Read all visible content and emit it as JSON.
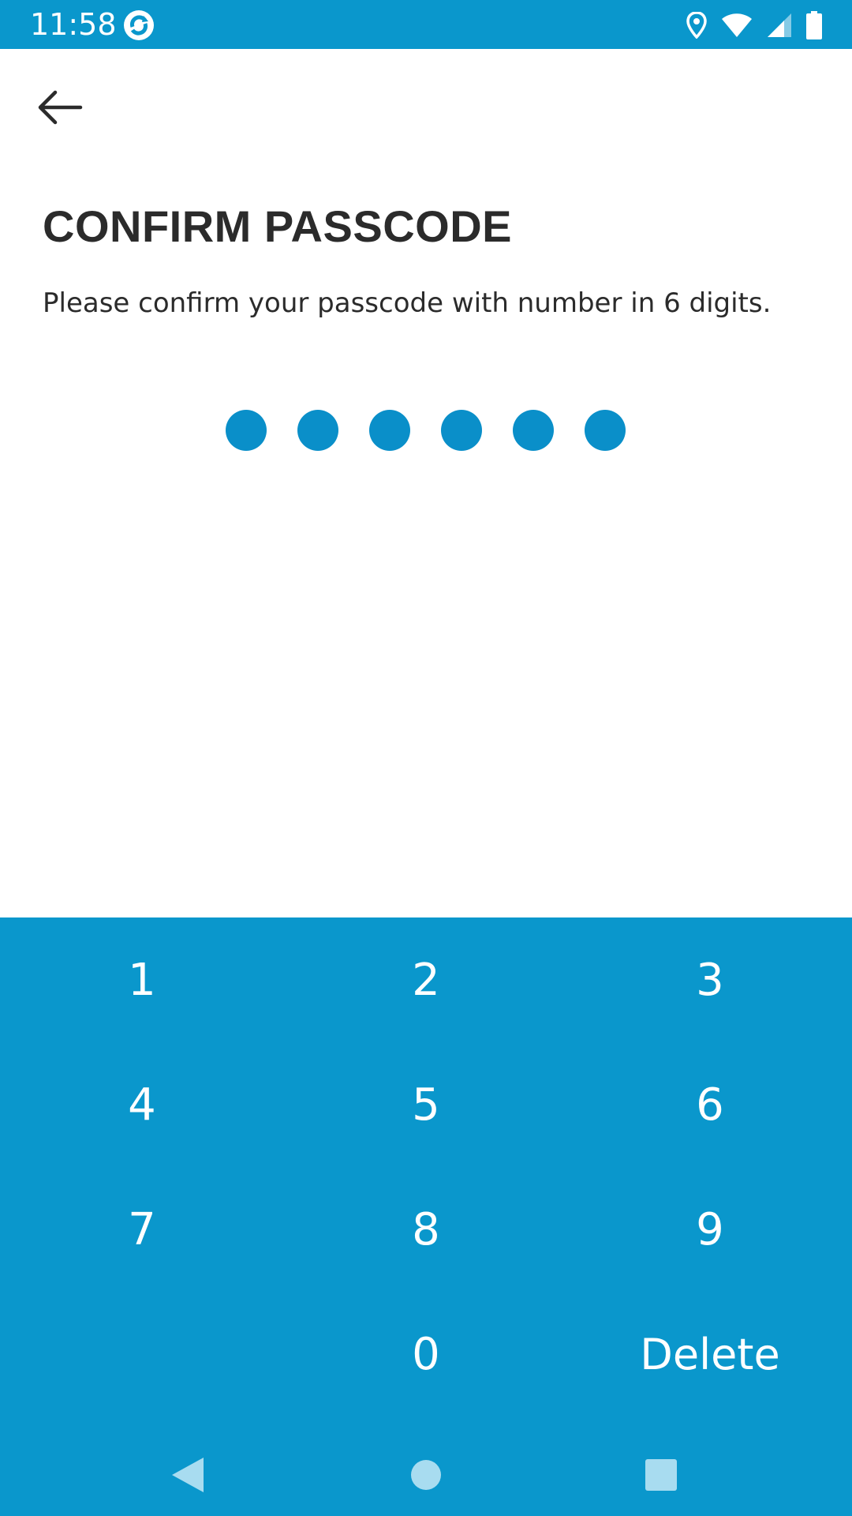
{
  "status_bar": {
    "time": "11:58",
    "icons": [
      "sync-app-icon",
      "location-icon",
      "wifi-icon",
      "signal-icon",
      "battery-icon"
    ]
  },
  "header": {
    "back_icon": "arrow-left-icon",
    "title": "CONFIRM PASSCODE",
    "subtitle": "Please confirm your passcode with number in 6 digits."
  },
  "passcode": {
    "length": 6,
    "entered": 6,
    "dot_color": "#0a8fc9"
  },
  "keypad": {
    "background": "#0a97cc",
    "keys": [
      "1",
      "2",
      "3",
      "4",
      "5",
      "6",
      "7",
      "8",
      "9",
      "",
      "0",
      "Delete"
    ]
  },
  "nav_bar": {
    "icons": [
      "nav-back-icon",
      "nav-home-icon",
      "nav-recents-icon"
    ]
  },
  "colors": {
    "accent": "#0a97cc",
    "text": "#2b2b2b",
    "background": "#ffffff"
  }
}
